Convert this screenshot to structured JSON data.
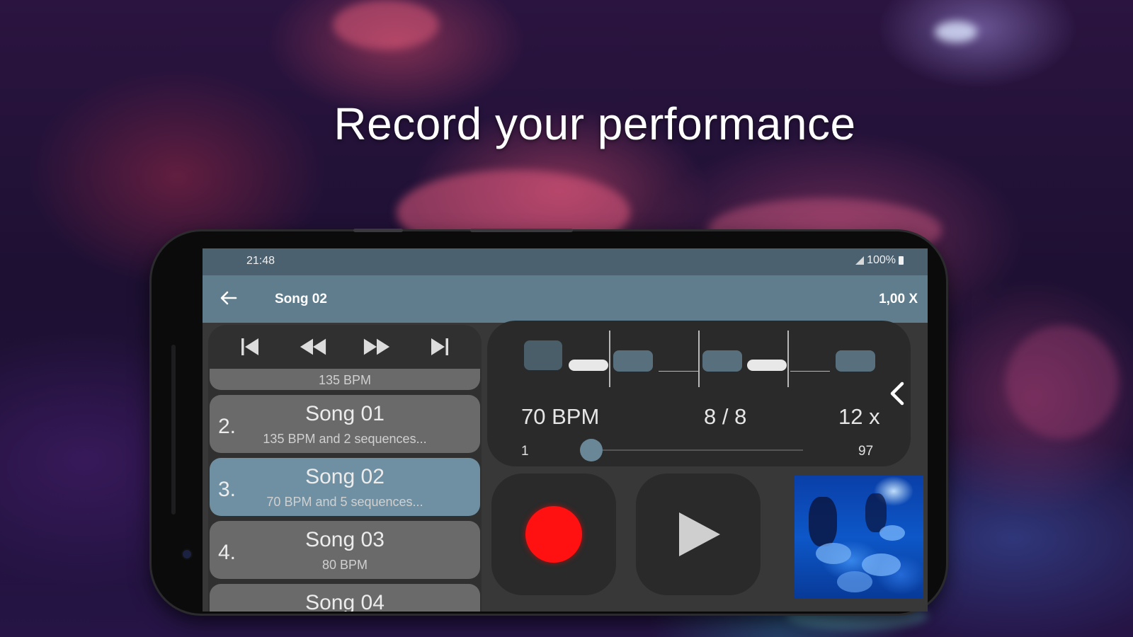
{
  "headline": "Record your performance",
  "status_bar": {
    "time": "21:48",
    "battery": "100%"
  },
  "toolbar": {
    "title": "Song 02",
    "speed": "1,00 X"
  },
  "songs": [
    {
      "number": "",
      "name": "",
      "detail": "135 BPM",
      "active": false
    },
    {
      "number": "2.",
      "name": "Song 01",
      "detail": "135 BPM and 2 sequences...",
      "active": false
    },
    {
      "number": "3.",
      "name": "Song 02",
      "detail": "70 BPM and 5 sequences...",
      "active": true
    },
    {
      "number": "4.",
      "name": "Song 03",
      "detail": "80 BPM",
      "active": false
    },
    {
      "number": "",
      "name": "Song 04",
      "detail": "",
      "active": false
    }
  ],
  "sequencer": {
    "bpm": "70 BPM",
    "time_signature": "8 / 8",
    "repeat": "12 x",
    "position_min": "1",
    "position_max": "97",
    "position_value": 1
  },
  "icons": {
    "back": "arrow-left-icon",
    "skip_start": "skip-to-start-icon",
    "rewind": "rewind-icon",
    "fast_forward": "fast-forward-icon",
    "skip_end": "skip-to-end-icon",
    "collapse": "chevron-left-icon",
    "record": "record-icon",
    "play": "play-icon"
  },
  "colors": {
    "status_bar": "#4b6170",
    "toolbar": "#5f7d8c",
    "active_item": "#6f90a2",
    "item": "#6a6a6a",
    "record": "#ff1111",
    "sequence_block": "#58707e"
  }
}
